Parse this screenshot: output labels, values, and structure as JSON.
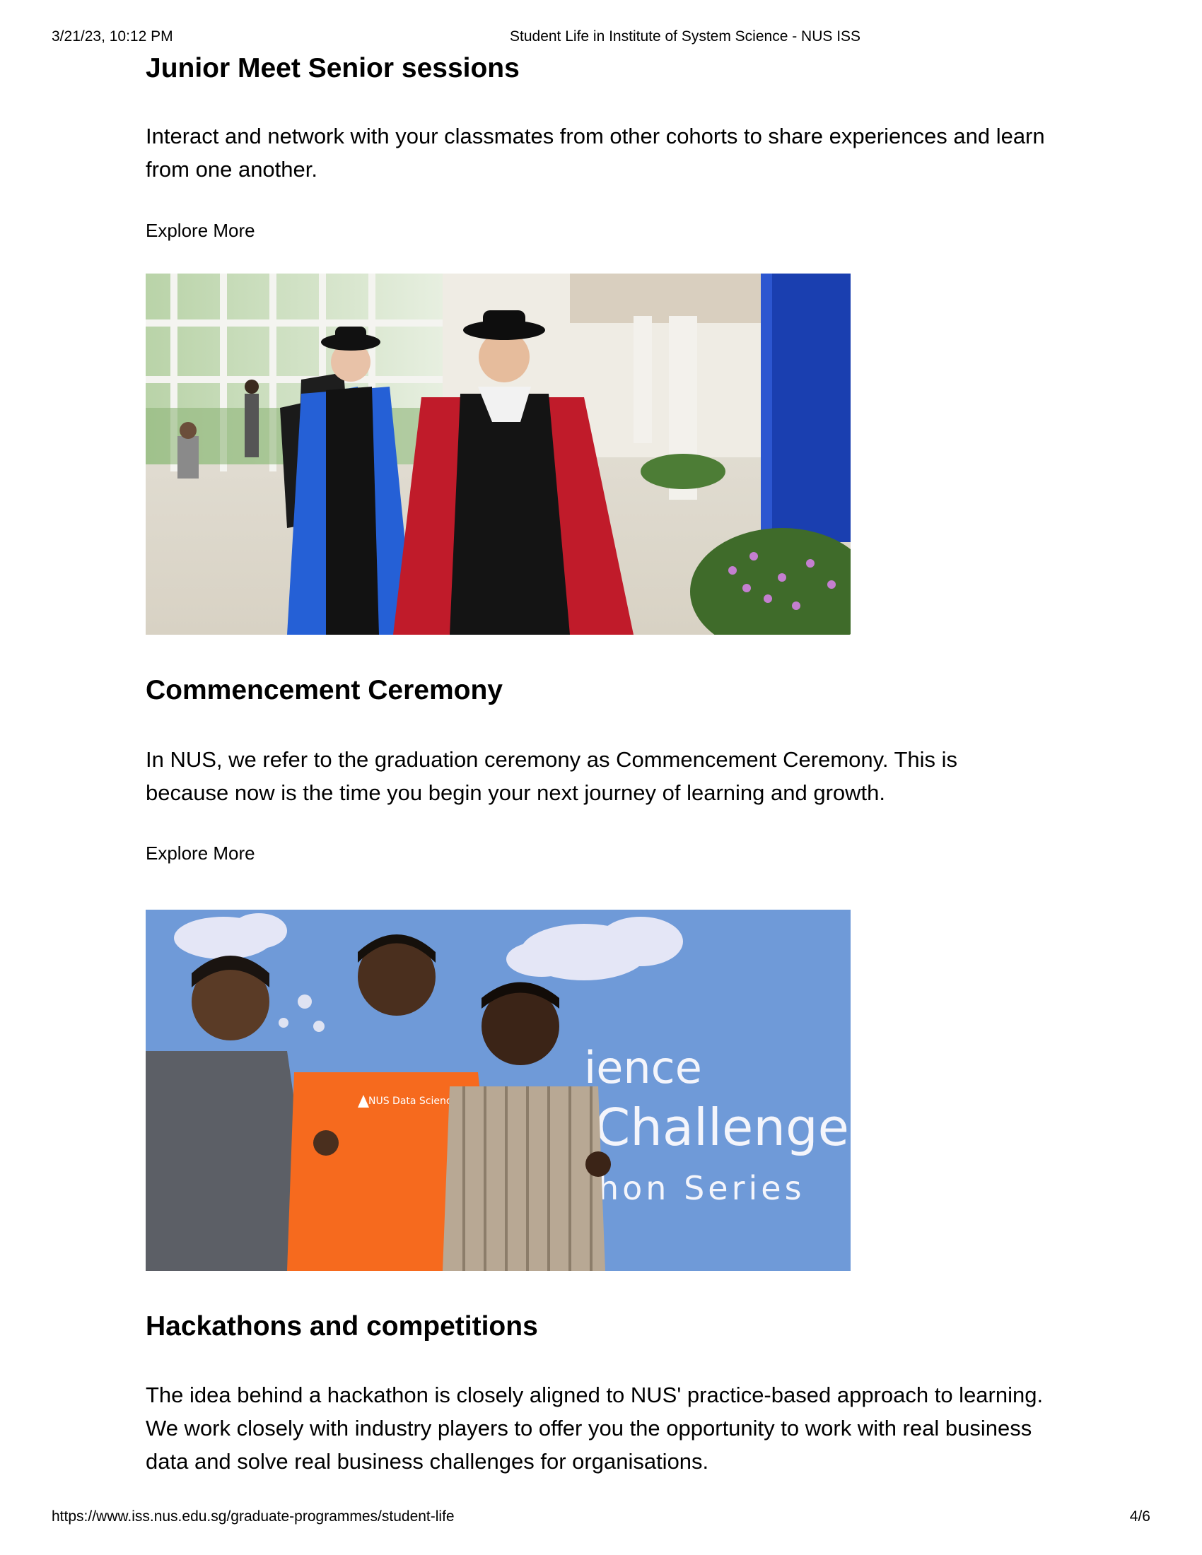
{
  "header": {
    "datetime": "3/21/23, 10:12 PM",
    "title": "Student Life in Institute of System Science - NUS ISS"
  },
  "sections": [
    {
      "heading": "Junior Meet Senior sessions",
      "text": "Interact and network with your classmates from other cohorts to share experiences and learn from one another.",
      "link": "Explore More"
    },
    {
      "heading": "Commencement Ceremony",
      "text": "In NUS, we refer to the graduation ceremony as Commencement Ceremony. This is because now is the time you begin your next journey of learning and growth.",
      "link": "Explore More"
    },
    {
      "heading": "Hackathons and competitions",
      "text": "The idea behind a hackathon is closely aligned to NUS' practice-based approach to learning. We work closely with industry players to offer you the opportunity to work with real business data and solve real business challenges for organisations."
    }
  ],
  "images": {
    "commencement_photo": {
      "icon": "photo-academic-procession"
    },
    "hackathon_photo": {
      "icon": "photo-students-hackathon",
      "backdrop_lines": [
        "ience",
        "Challenge",
        "hon Series"
      ],
      "shirt_text": "NUS Data Science Student Challenge"
    }
  },
  "footer": {
    "url": "https://www.iss.nus.edu.sg/graduate-programmes/student-life",
    "page": "4/6"
  }
}
